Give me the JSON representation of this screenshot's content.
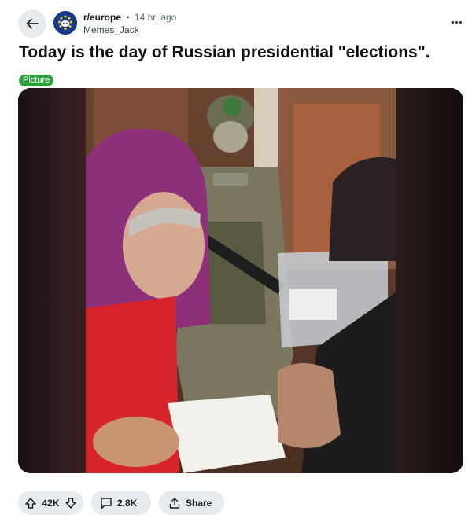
{
  "post": {
    "subreddit": "r/europe",
    "separator": "•",
    "time": "14 hr. ago",
    "author": "Memes_Jack",
    "title": "Today is the day of Russian presidential \"elections\".",
    "flair": "Picture",
    "flair_color": "#2e9e3f"
  },
  "actions": {
    "votes": "42K",
    "comments": "2.8K",
    "share_label": "Share"
  },
  "icons": {
    "back": "arrow-left-icon",
    "avatar": "subreddit-avatar-icon",
    "more": "more-options-icon",
    "upvote": "upvote-arrow-icon",
    "downvote": "downvote-arrow-icon",
    "comment": "comment-bubble-icon",
    "share": "share-icon"
  },
  "colors": {
    "pill_bg": "#e5ebee",
    "avatar_bg": "#173a8a"
  }
}
